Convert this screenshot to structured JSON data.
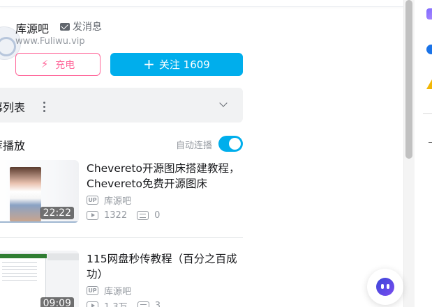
{
  "up": {
    "name": "库源吧",
    "message_label": "发消息",
    "description": "www.Fuliwu.vip",
    "charge_label": "充电",
    "follow_label": "关注 1609"
  },
  "playlist": {
    "title": "幕列表"
  },
  "recommend": {
    "title": "荐播放",
    "autoplay_label": "自动连播",
    "autoplay_on": true
  },
  "videos": [
    {
      "title": "Chevereto开源图床搭建教程，Chevereto免费开源图床",
      "duration": "22:22",
      "owner": "库源吧",
      "views": "1322",
      "danmaku": "0"
    },
    {
      "title": "115网盘秒传教程（百分之百成功）",
      "duration": "09:09",
      "owner": "库源吧",
      "views": "1.3万",
      "danmaku": "3"
    }
  ],
  "icons": {
    "charge": "bolt-icon",
    "follow": "plus-icon",
    "message": "mail-icon",
    "more": "more-vertical-icon",
    "expand": "chevron-down-icon",
    "owner_badge": "up-badge-icon",
    "views": "play-count-icon",
    "danmaku": "danmaku-icon",
    "assistant": "assistant-icon"
  },
  "colors": {
    "accent": "#00aeec",
    "charge": "#ff6699",
    "text_primary": "#18191c",
    "text_secondary": "#9499a0"
  }
}
